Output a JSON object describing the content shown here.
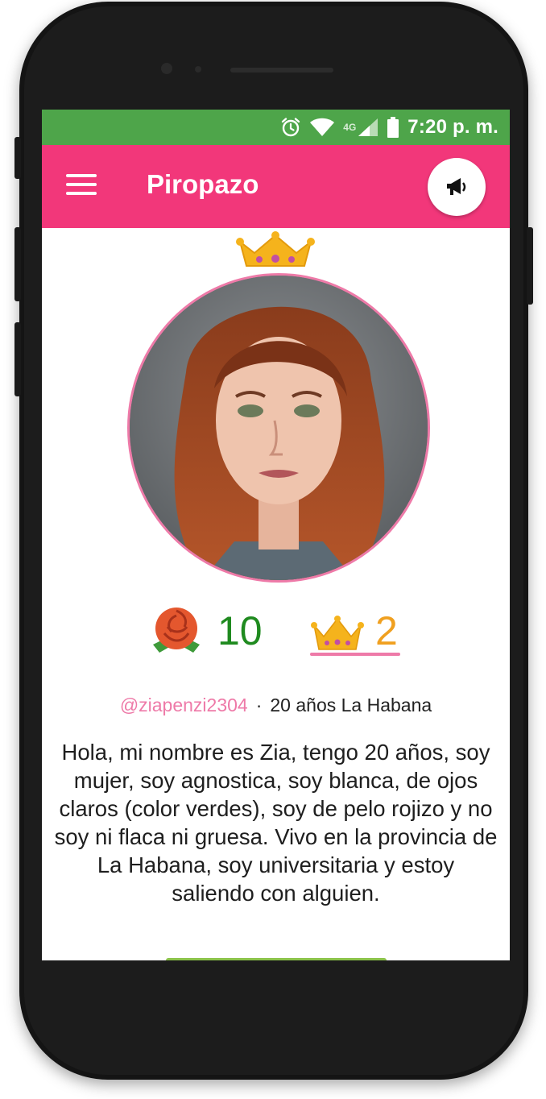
{
  "status_bar": {
    "time": "7:20 p. m.",
    "network": "4G",
    "icons": [
      "alarm-icon",
      "wifi-icon",
      "signal-icon",
      "battery-icon"
    ]
  },
  "app_bar": {
    "title": "Piropazo",
    "menu_icon": "hamburger-menu-icon",
    "action_icon": "megaphone-icon"
  },
  "profile": {
    "crown_icon": "crown-icon",
    "roses": "10",
    "crowns": "2",
    "username": "@ziapenzi2304",
    "separator": "·",
    "details": "20 años La Habana",
    "bio": "Hola, mi nombre es Zia, tengo 20 años, soy mujer, soy agnostica, soy blanca, de ojos claros (color verdes), soy de pelo rojizo y no soy ni flaca ni gruesa. Vivo en la provincia de La Habana, soy universitaria y estoy saliendo con alguien."
  },
  "colors": {
    "status_bar": "#4ea54a",
    "app_bar": "#f2377a",
    "accent_pink": "#ee7aa8",
    "rose_count": "#1f8a1f",
    "crown_count": "#f0a020"
  }
}
